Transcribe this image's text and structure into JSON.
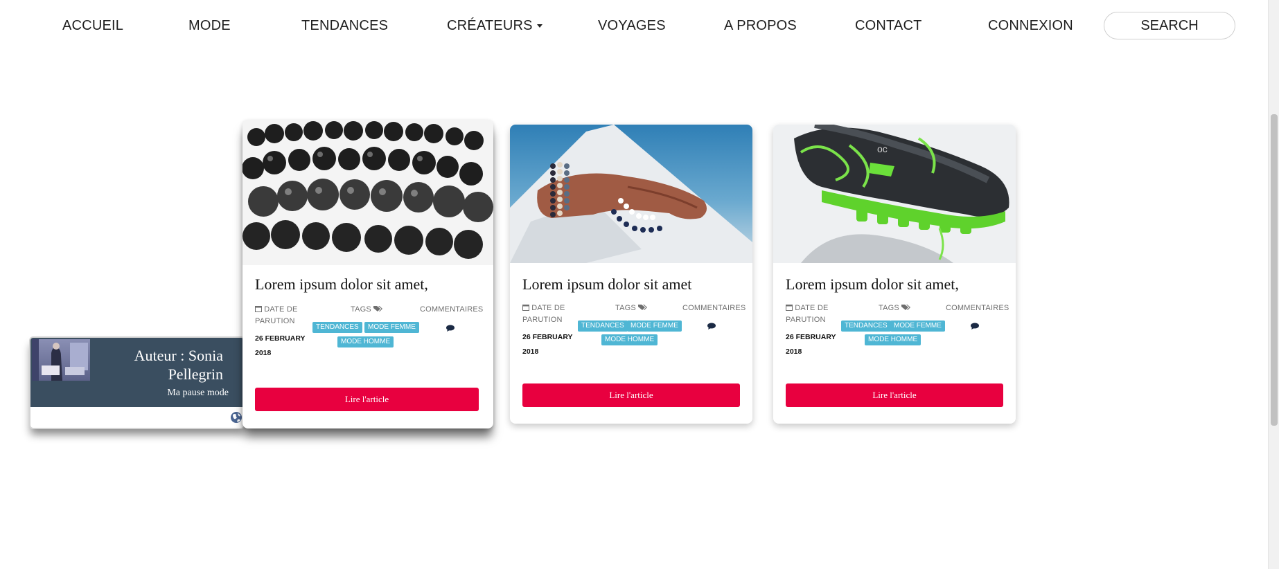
{
  "nav": {
    "items": [
      {
        "label": "ACCUEIL"
      },
      {
        "label": "MODE"
      },
      {
        "label": "TENDANCES"
      },
      {
        "label": "CRÉATEURS"
      },
      {
        "label": "VOYAGES"
      },
      {
        "label": "A PROPOS"
      },
      {
        "label": "CONTACT"
      },
      {
        "label": "CONNEXION"
      }
    ],
    "search_label": "SEARCH"
  },
  "author": {
    "name": "Auteur : Sonia Pellegrin",
    "subtitle": "Ma pause mode"
  },
  "cards": [
    {
      "title": "Lorem ipsum dolor sit amet,",
      "date_label": "DATE DE PARUTION",
      "date": "26 FEBRUARY 2018",
      "tags_label": "TAGS",
      "tags": [
        "TENDANCES",
        "MODE FEMME",
        "MODE HOMME"
      ],
      "comments_label": "COMMENTAIRES",
      "button_label": "Lire l'article"
    },
    {
      "title": "Lorem ipsum dolor sit amet",
      "date_label": "DATE DE PARUTION",
      "date": "26 FEBRUARY 2018",
      "tags_label": "TAGS",
      "tags": [
        "TENDANCES",
        "MODE FEMME",
        "MODE HOMME"
      ],
      "comments_label": "COMMENTAIRES",
      "button_label": "Lire l'article"
    },
    {
      "title": "Lorem ipsum dolor sit amet,",
      "date_label": "DATE DE PARUTION",
      "date": "26 FEBRUARY 2018",
      "tags_label": "TAGS",
      "tags": [
        "TENDANCES",
        "MODE FEMME",
        "MODE HOMME"
      ],
      "comments_label": "COMMENTAIRES",
      "button_label": "Lire l'article"
    }
  ],
  "colors": {
    "accent_button": "#e8003f",
    "tag": "#4fb6d4",
    "author_panel": "#3a4e60"
  },
  "icons": [
    "calendar-icon",
    "tags-icon",
    "comment-icon",
    "globe-icon",
    "caret-down-icon"
  ]
}
